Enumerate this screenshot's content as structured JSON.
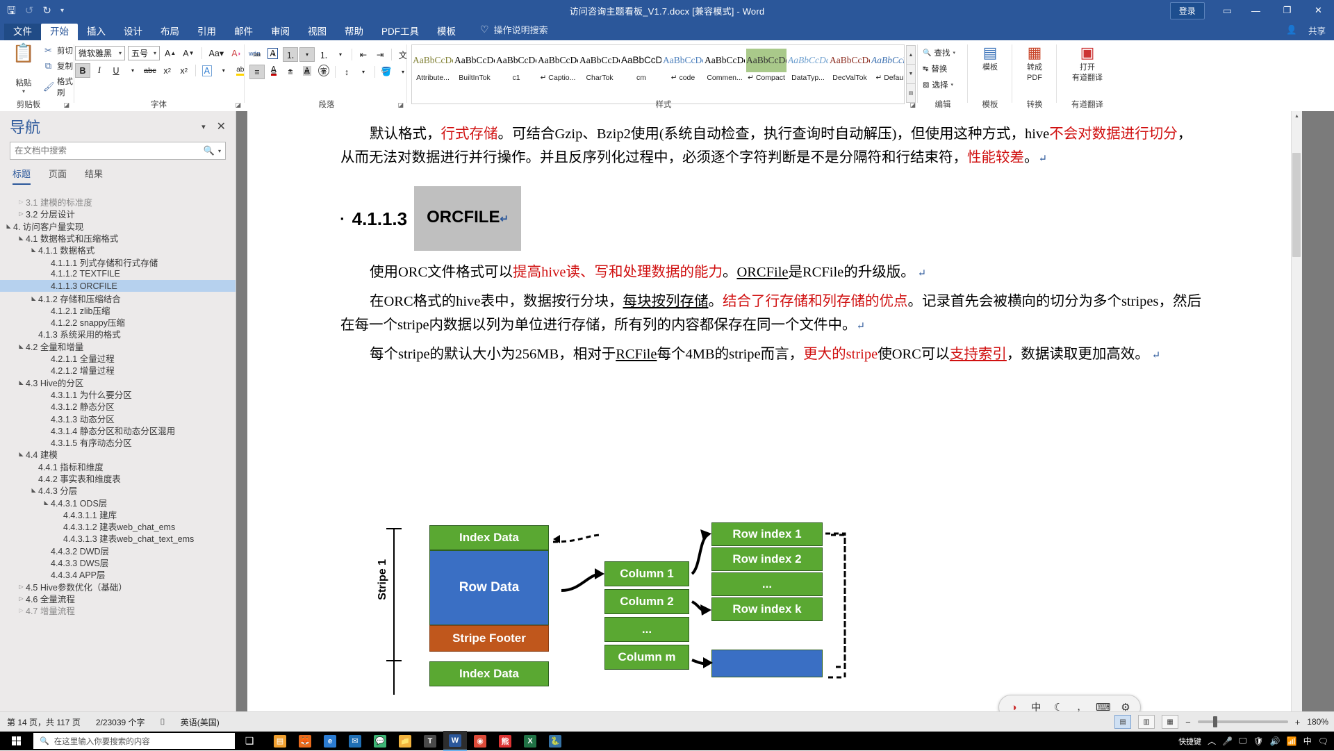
{
  "window": {
    "title": "访问咨询主题看板_V1.7.docx [兼容模式]  -  Word",
    "signin_label": "登录",
    "ribbon_display_icon": "▭",
    "minimize_icon": "—",
    "restore_icon": "❐",
    "close_icon": "✕",
    "share_label": "共享",
    "share_icon": "👤"
  },
  "qat": {
    "save_icon": "🖫",
    "undo_icon": "↺",
    "redo_icon": "↻",
    "customize_icon": "▾"
  },
  "tabs": [
    {
      "label": "文件",
      "active": false,
      "file": true
    },
    {
      "label": "开始",
      "active": true,
      "file": false
    },
    {
      "label": "插入",
      "active": false,
      "file": false
    },
    {
      "label": "设计",
      "active": false,
      "file": false
    },
    {
      "label": "布局",
      "active": false,
      "file": false
    },
    {
      "label": "引用",
      "active": false,
      "file": false
    },
    {
      "label": "邮件",
      "active": false,
      "file": false
    },
    {
      "label": "审阅",
      "active": false,
      "file": false
    },
    {
      "label": "视图",
      "active": false,
      "file": false
    },
    {
      "label": "帮助",
      "active": false,
      "file": false
    },
    {
      "label": "PDF工具",
      "active": false,
      "file": false
    },
    {
      "label": "模板",
      "active": false,
      "file": false
    }
  ],
  "tellme": {
    "label": "操作说明搜索",
    "icon": "♡"
  },
  "ribbon": {
    "groups": [
      {
        "name": "剪贴板"
      },
      {
        "name": "字体"
      },
      {
        "name": "段落"
      },
      {
        "name": "样式"
      },
      {
        "name": "编辑"
      },
      {
        "name": "模板"
      },
      {
        "name": "转换"
      },
      {
        "name": "有道翻译"
      }
    ],
    "clipboard": {
      "paste_label": "粘贴",
      "paste_icon": "📋",
      "items": [
        {
          "label": "剪切",
          "icon": "✂"
        },
        {
          "label": "复制",
          "icon": "⧉"
        },
        {
          "label": "格式刷",
          "icon": "🖌"
        }
      ]
    },
    "font": {
      "family": "微软雅黑",
      "size": "五号",
      "grow_icon": "A",
      "shrink_icon": "A",
      "case_icon": "Aa",
      "clear_icon": "A",
      "bold": "B",
      "italic": "I",
      "underline": "U",
      "strike": "abc",
      "subscript": "x",
      "superscript": "x",
      "texteffects": "A",
      "highlight": "ab",
      "fontcolor": "A",
      "phonetic_icon": "wén",
      "border_icon": "A",
      "charshade_icon": "A",
      "enclose_icon": "字"
    },
    "paragraph": {
      "bullets": "≔",
      "numbering": "⒈",
      "multilevel": "⒈",
      "dec_indent": "⇤",
      "inc_indent": "⇥",
      "sort": "A↓",
      "marks": "¶",
      "align_left": "≡",
      "align_center": "≡",
      "align_right": "≡",
      "justify": "≡",
      "distribute": "≡",
      "linespacing": "↕",
      "shading": "🪣",
      "borders": "⊞",
      "asianlayout": "文"
    },
    "styles": [
      {
        "preview": "AaBbCcDc",
        "name": "Attribute...",
        "color": "#7f7f33",
        "serif": true,
        "selected": false
      },
      {
        "preview": "AaBbCcDc",
        "name": "BuiltInTok",
        "color": "#000000",
        "serif": true,
        "selected": false
      },
      {
        "preview": "AaBbCcDc",
        "name": "c1",
        "color": "#000000",
        "serif": true,
        "selected": false
      },
      {
        "preview": "AaBbCcDc",
        "name": "↵ Captio...",
        "color": "#000000",
        "serif": true,
        "selected": false
      },
      {
        "preview": "AaBbCcDc",
        "name": "CharTok",
        "color": "#000000",
        "serif": true,
        "selected": false
      },
      {
        "preview": "AaBbCcD",
        "name": "cm",
        "color": "#000000",
        "serif": false,
        "selected": false
      },
      {
        "preview": "AaBbCcDc",
        "name": "↵ code",
        "color": "#4a7ebb",
        "serif": true,
        "selected": false
      },
      {
        "preview": "AaBbCcDc",
        "name": "Commen...",
        "color": "#000000",
        "serif": true,
        "selected": false
      },
      {
        "preview": "AaBbCcDdl",
        "name": "↵ Compact",
        "color": "#333333",
        "serif": true,
        "selected": true
      },
      {
        "preview": "AaBbCcDc",
        "name": "DataTyp...",
        "color": "#6fa0cf",
        "serif": true,
        "selected": false
      },
      {
        "preview": "AaBbCcDc",
        "name": "DecValTok",
        "color": "#8b2b1f",
        "serif": true,
        "selected": false
      },
      {
        "preview": "AaBbCcDc",
        "name": "↵ Default",
        "color": "#3a6fb0",
        "serif": true,
        "selected": false
      }
    ],
    "editing": [
      {
        "label": "查找",
        "icon": "🔍"
      },
      {
        "label": "替换",
        "icon": "↹"
      },
      {
        "label": "选择",
        "icon": "▨"
      }
    ],
    "template_btn": {
      "label": "模板",
      "icon": "▤"
    },
    "convert_btn": {
      "label1": "转成",
      "label2": "PDF",
      "icon": "▦"
    },
    "youdao_btn": {
      "label1": "打开",
      "label2": "有道翻译",
      "icon": "▣"
    }
  },
  "navigation": {
    "title": "导航",
    "collapse_icon": "▾",
    "close_icon": "✕",
    "search_placeholder": "在文档中搜索",
    "search_value": "",
    "search_icon": "🔍",
    "search_dropdown_icon": "▾",
    "tabs": [
      {
        "label": "标题",
        "active": true
      },
      {
        "label": "页面",
        "active": false
      },
      {
        "label": "结果",
        "active": false
      }
    ],
    "tree": [
      {
        "label": "3.1  建模的标准度",
        "indent": 2,
        "state": "closed",
        "selected": false,
        "clipped": true
      },
      {
        "label": "3.2  分层设计",
        "indent": 2,
        "state": "closed",
        "selected": false
      },
      {
        "label": "4.  访问客户量实现",
        "indent": 1,
        "state": "open",
        "selected": false
      },
      {
        "label": "4.1  数据格式和压缩格式",
        "indent": 2,
        "state": "open",
        "selected": false
      },
      {
        "label": "4.1.1  数据格式",
        "indent": 3,
        "state": "open",
        "selected": false
      },
      {
        "label": "4.1.1.1  列式存储和行式存储",
        "indent": 4,
        "state": "leaf",
        "selected": false
      },
      {
        "label": "4.1.1.2  TEXTFILE",
        "indent": 4,
        "state": "leaf",
        "selected": false
      },
      {
        "label": "4.1.1.3  ORCFILE",
        "indent": 4,
        "state": "leaf",
        "selected": true
      },
      {
        "label": "4.1.2  存储和压缩结合",
        "indent": 3,
        "state": "open",
        "selected": false
      },
      {
        "label": "4.1.2.1  zlib压缩",
        "indent": 4,
        "state": "leaf",
        "selected": false
      },
      {
        "label": "4.1.2.2  snappy压缩",
        "indent": 4,
        "state": "leaf",
        "selected": false
      },
      {
        "label": "4.1.3  系统采用的格式",
        "indent": 3,
        "state": "leaf",
        "selected": false
      },
      {
        "label": "4.2  全量和增量",
        "indent": 2,
        "state": "open",
        "selected": false
      },
      {
        "label": "4.2.1.1  全量过程",
        "indent": 4,
        "state": "leaf",
        "selected": false
      },
      {
        "label": "4.2.1.2  增量过程",
        "indent": 4,
        "state": "leaf",
        "selected": false
      },
      {
        "label": "4.3  Hive的分区",
        "indent": 2,
        "state": "open",
        "selected": false
      },
      {
        "label": "4.3.1.1  为什么要分区",
        "indent": 4,
        "state": "leaf",
        "selected": false
      },
      {
        "label": "4.3.1.2  静态分区",
        "indent": 4,
        "state": "leaf",
        "selected": false
      },
      {
        "label": "4.3.1.3  动态分区",
        "indent": 4,
        "state": "leaf",
        "selected": false
      },
      {
        "label": "4.3.1.4  静态分区和动态分区混用",
        "indent": 4,
        "state": "leaf",
        "selected": false
      },
      {
        "label": "4.3.1.5  有序动态分区",
        "indent": 4,
        "state": "leaf",
        "selected": false
      },
      {
        "label": "4.4  建模",
        "indent": 2,
        "state": "open",
        "selected": false
      },
      {
        "label": "4.4.1  指标和维度",
        "indent": 3,
        "state": "leaf",
        "selected": false
      },
      {
        "label": "4.4.2  事实表和维度表",
        "indent": 3,
        "state": "leaf",
        "selected": false
      },
      {
        "label": "4.4.3  分层",
        "indent": 3,
        "state": "open",
        "selected": false
      },
      {
        "label": "4.4.3.1  ODS层",
        "indent": 4,
        "state": "open",
        "selected": false
      },
      {
        "label": "4.4.3.1.1  建库",
        "indent": 5,
        "state": "leaf",
        "selected": false
      },
      {
        "label": "4.4.3.1.2  建表web_chat_ems",
        "indent": 5,
        "state": "leaf",
        "selected": false
      },
      {
        "label": "4.4.3.1.3  建表web_chat_text_ems",
        "indent": 5,
        "state": "leaf",
        "selected": false
      },
      {
        "label": "4.4.3.2  DWD层",
        "indent": 4,
        "state": "leaf",
        "selected": false
      },
      {
        "label": "4.4.3.3  DWS层",
        "indent": 4,
        "state": "leaf",
        "selected": false
      },
      {
        "label": "4.4.3.4  APP层",
        "indent": 4,
        "state": "leaf",
        "selected": false
      },
      {
        "label": "4.5  Hive参数优化（基础）",
        "indent": 2,
        "state": "closed",
        "selected": false
      },
      {
        "label": "4.6  全量流程",
        "indent": 2,
        "state": "closed",
        "selected": false
      },
      {
        "label": "4.7  增量流程",
        "indent": 2,
        "state": "closed",
        "selected": false,
        "clipped": true
      }
    ]
  },
  "document": {
    "paragraphs": [
      {
        "id": "p1",
        "runs": [
          {
            "t": "默认格式，",
            "c": "black"
          },
          {
            "t": "行式存储",
            "c": "red"
          },
          {
            "t": "。可结合Gzip、Bzip2使用(系统自动检查，执行查询时自动解压)，但使用这种方式，hive",
            "c": "black"
          },
          {
            "t": "不会对数据进行切分",
            "c": "red"
          },
          {
            "t": "，从而无法对数据进行并行操作。并且反序列化过程中，必须逐个字符判断是不是分隔符和行结束符，",
            "c": "black"
          },
          {
            "t": "性能较差",
            "c": "red"
          },
          {
            "t": "。",
            "c": "black"
          },
          {
            "t": "↵",
            "c": "mark"
          }
        ]
      }
    ],
    "heading": {
      "bullet": "▪",
      "number": "4.1.1.3",
      "text": "ORCFILE",
      "mark": "↵"
    },
    "paragraphs2": [
      {
        "id": "p2",
        "runs": [
          {
            "t": "使用ORC文件格式可以",
            "c": "black"
          },
          {
            "t": "提高hive读、写和处理数据的能力",
            "c": "red"
          },
          {
            "t": "。",
            "c": "black"
          },
          {
            "t": "ORCFile",
            "c": "black-ul"
          },
          {
            "t": "是RCFile的升级版。",
            "c": "black"
          },
          {
            "t": " ↵",
            "c": "mark"
          }
        ]
      },
      {
        "id": "p3",
        "runs": [
          {
            "t": "在ORC格式的hive表中，数据按行分块，",
            "c": "black"
          },
          {
            "t": "每块按列存储",
            "c": "black-ul"
          },
          {
            "t": "。",
            "c": "black"
          },
          {
            "t": "结合了行存储和列存储的优点",
            "c": "red"
          },
          {
            "t": "。记录首先会被横向的切分为多个stripes，然后在每一个stripe内数据以列为单位进行存储，所有列的内容都保存在同一个文件中。",
            "c": "black"
          },
          {
            "t": "↵",
            "c": "mark"
          }
        ]
      },
      {
        "id": "p4",
        "runs": [
          {
            "t": "每个stripe的默认大小为256MB，相对于",
            "c": "black"
          },
          {
            "t": "RCFile",
            "c": "black-ul"
          },
          {
            "t": "每个4MB的stripe而言，",
            "c": "black"
          },
          {
            "t": "更大的stripe",
            "c": "red"
          },
          {
            "t": "使ORC可以",
            "c": "black"
          },
          {
            "t": "支持索引",
            "c": "red-ul"
          },
          {
            "t": "，数据读取更加高效。",
            "c": "black"
          },
          {
            "t": " ↵",
            "c": "mark"
          }
        ]
      }
    ],
    "diagram": {
      "stripe_label": "Stripe 1",
      "boxes": [
        {
          "label": "Index Data",
          "color": "green"
        },
        {
          "label": "Row Data",
          "color": "blue"
        },
        {
          "label": "Stripe Footer",
          "color": "orange"
        },
        {
          "label": "Index Data",
          "color": "green"
        }
      ],
      "columns": [
        {
          "label": "Column 1",
          "color": "green"
        },
        {
          "label": "Column 2",
          "color": "green"
        },
        {
          "label": "...",
          "color": "green"
        },
        {
          "label": "Column m",
          "color": "green"
        }
      ],
      "rowindex": [
        {
          "label": "Row index 1",
          "color": "green"
        },
        {
          "label": "Row index 2",
          "color": "green"
        },
        {
          "label": "...",
          "color": "green"
        },
        {
          "label": "Row index k",
          "color": "green"
        }
      ],
      "bottom_box": {
        "label": "",
        "color": "blue"
      }
    }
  },
  "ime": {
    "logo_icon": "◑",
    "mode_label": "中",
    "moon_icon": "☾",
    "punct_icon": "，",
    "keyboard_icon": "⌨",
    "settings_icon": "⚙"
  },
  "statusbar": {
    "page": "第 14 页，共 117 页",
    "words": "2/23039 个字",
    "proof_icon": "⌷",
    "language": "英语(美国)",
    "view_print": "▤",
    "view_web": "▥",
    "view_read": "▦",
    "zoom_out": "−",
    "zoom_in": "+",
    "zoom_level": "180%"
  },
  "taskbar": {
    "search_placeholder": "在这里输入你要搜索的内容",
    "search_icon": "🔍",
    "taskview_icon": "❑",
    "apps": [
      {
        "name": "explorer-taskbar-icon",
        "glyph": "▤",
        "color": "#f0a030",
        "active": false
      },
      {
        "name": "firefox-taskbar-icon",
        "glyph": "🦊",
        "color": "#e86a1c",
        "active": false
      },
      {
        "name": "edge-taskbar-icon",
        "glyph": "e",
        "color": "#2b7cd3",
        "active": false
      },
      {
        "name": "mail-taskbar-icon",
        "glyph": "✉",
        "color": "#1f6fb5",
        "active": false
      },
      {
        "name": "wechat-taskbar-icon",
        "glyph": "💬",
        "color": "#3eb575",
        "active": false
      },
      {
        "name": "folder-taskbar-icon",
        "glyph": "📁",
        "color": "#f2b33d",
        "active": false
      },
      {
        "name": "typora-taskbar-icon",
        "glyph": "T",
        "color": "#4a4a4a",
        "active": false
      },
      {
        "name": "word-taskbar-icon",
        "glyph": "W",
        "color": "#2b579a",
        "active": true
      },
      {
        "name": "chrome-taskbar-icon",
        "glyph": "◉",
        "color": "#dd4b39",
        "active": false
      },
      {
        "name": "baidu-taskbar-icon",
        "glyph": "熊",
        "color": "#d33",
        "active": false
      },
      {
        "name": "excel-taskbar-icon",
        "glyph": "X",
        "color": "#207245",
        "active": false
      },
      {
        "name": "python-taskbar-icon",
        "glyph": "🐍",
        "color": "#3572A5",
        "active": false
      }
    ],
    "tray": {
      "shortcut_label": "快捷键",
      "expand_icon": "︿",
      "mic_icon": "🎤",
      "screen_icon": "🖵",
      "shield_icon": "🛡",
      "volume_icon": "🔊",
      "network_icon": "📶",
      "ime_icon": "中",
      "notify_icon": "🗨"
    }
  }
}
